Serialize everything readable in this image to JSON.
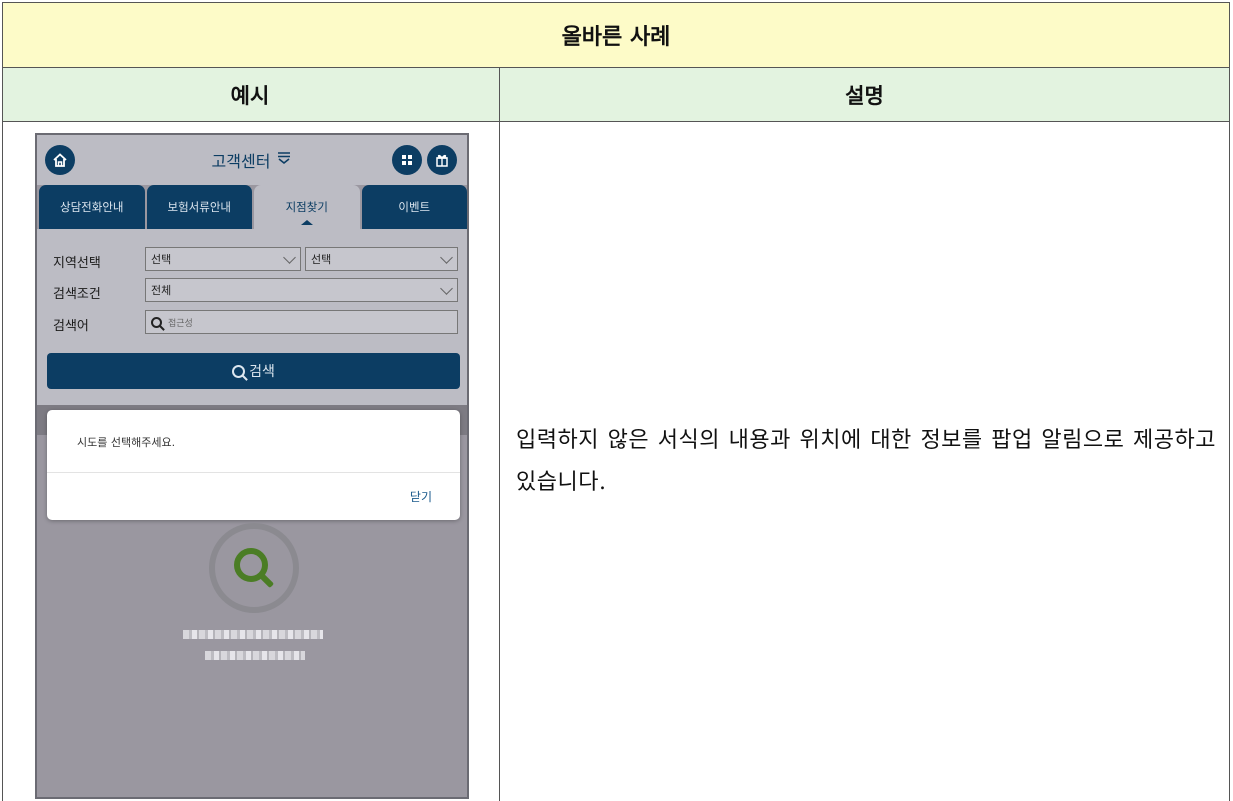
{
  "table": {
    "title": "올바른 사례",
    "col_example": "예시",
    "col_description": "설명",
    "description": "입력하지 않은 서식의 내용과 위치에 대한 정보를 팝업 알림으로 제공하고 있습니다."
  },
  "mobile": {
    "header_title": "고객센터",
    "tabs": [
      "상담전화안내",
      "보험서류안내",
      "지점찾기",
      "이벤트"
    ],
    "active_tab": "지점찾기",
    "form": {
      "region_label": "지역선택",
      "region_select_1": "선택",
      "region_select_2": "선택",
      "condition_label": "검색조건",
      "condition_value": "전체",
      "keyword_label": "검색어",
      "keyword_placeholder": "접근성"
    },
    "search_button": "검색",
    "dialog": {
      "message": "시도를 선택해주세요.",
      "close_label": "닫기"
    }
  }
}
